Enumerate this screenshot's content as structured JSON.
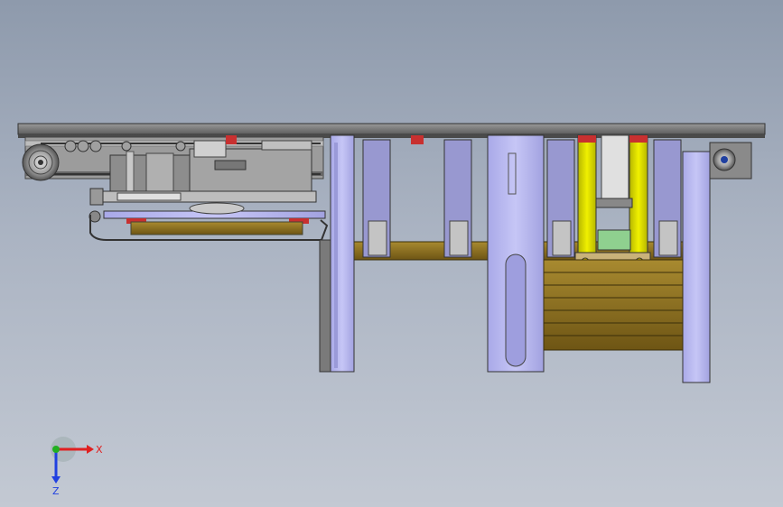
{
  "window": {
    "title": ""
  },
  "colors": {
    "background_top": "#8e9aac",
    "background_bottom": "#c3c9d3",
    "frame_steel": "#707070",
    "lavender_plate": "#b9b9f0",
    "wood_deck": "#8a6d1e",
    "cylinder_yellow": "#d8d800",
    "marker_red": "#d03030",
    "axis_x": "#e02020",
    "axis_y": "#20b020",
    "axis_z": "#2040e0"
  },
  "triad": {
    "x_label": "X",
    "z_label": "Z",
    "icon": "coordinate-triad-icon"
  }
}
